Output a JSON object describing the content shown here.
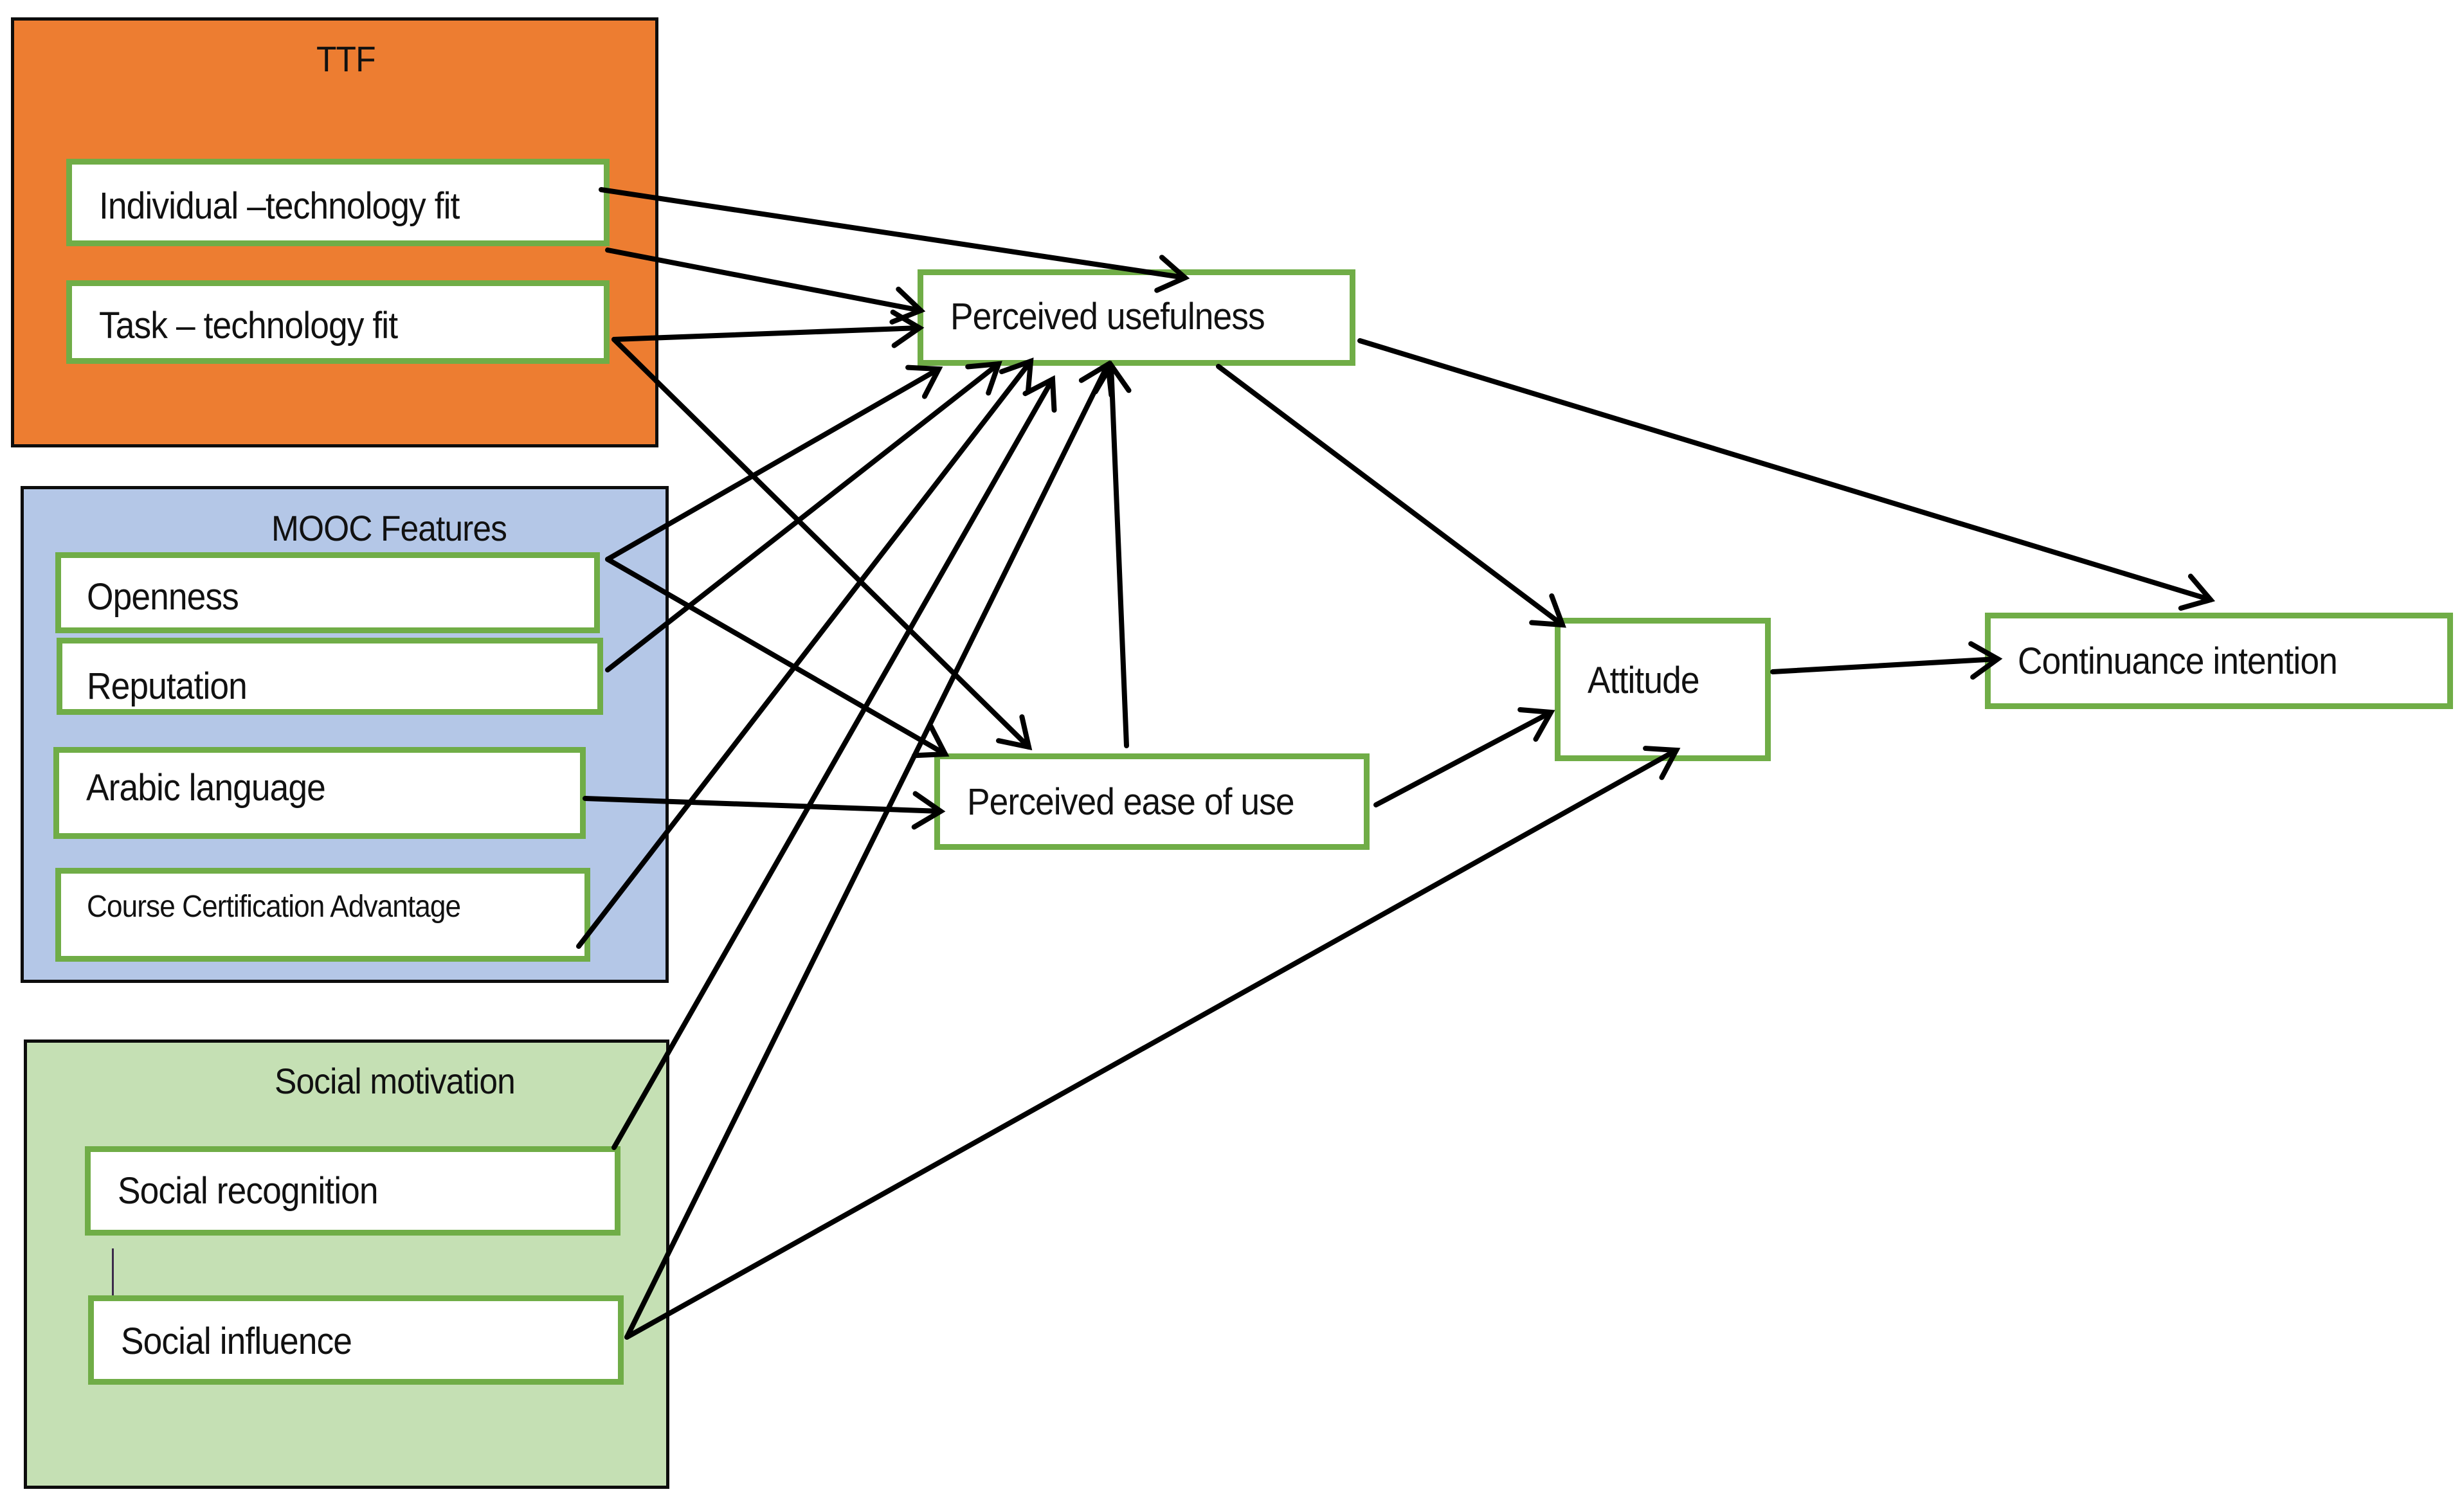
{
  "diagram": {
    "type": "research-model",
    "colors": {
      "ttf_group": "#ED7D31",
      "mooc_group": "#B4C7E7",
      "social_group": "#C5E0B4",
      "node_border": "#70AD47",
      "group_border": "#0D0D0D",
      "edge": "#000000"
    },
    "groups": [
      {
        "id": "ttf",
        "label": "TTF"
      },
      {
        "id": "mooc",
        "label": "MOOC Features"
      },
      {
        "id": "social",
        "label": "Social motivation"
      }
    ],
    "nodes": {
      "individual_fit": {
        "label": "Individual –technology fit",
        "group": "ttf"
      },
      "task_fit": {
        "label": "Task – technology fit",
        "group": "ttf"
      },
      "openness": {
        "label": "Openness",
        "group": "mooc"
      },
      "reputation": {
        "label": "Reputation",
        "group": "mooc"
      },
      "arabic": {
        "label": "Arabic language",
        "group": "mooc"
      },
      "certification": {
        "label": "Course Certification Advantage",
        "group": "mooc"
      },
      "social_recognition": {
        "label": "Social recognition",
        "group": "social"
      },
      "social_influence": {
        "label": "Social influence",
        "group": "social"
      },
      "pu": {
        "label": "Perceived usefulness"
      },
      "peou": {
        "label": "Perceived ease of use"
      },
      "attitude": {
        "label": "Attitude"
      },
      "ci": {
        "label": "Continuance intention"
      }
    },
    "edges": [
      {
        "from": "individual_fit",
        "to": "pu"
      },
      {
        "from": "individual_fit",
        "to": "pu"
      },
      {
        "from": "task_fit",
        "to": "pu"
      },
      {
        "from": "task_fit",
        "to": "peou"
      },
      {
        "from": "openness",
        "to": "pu"
      },
      {
        "from": "openness",
        "to": "peou"
      },
      {
        "from": "reputation",
        "to": "pu"
      },
      {
        "from": "arabic",
        "to": "peou"
      },
      {
        "from": "certification",
        "to": "pu"
      },
      {
        "from": "social_recognition",
        "to": "pu"
      },
      {
        "from": "social_influence",
        "to": "pu"
      },
      {
        "from": "social_influence",
        "to": "attitude"
      },
      {
        "from": "peou",
        "to": "pu"
      },
      {
        "from": "pu",
        "to": "attitude"
      },
      {
        "from": "pu",
        "to": "ci"
      },
      {
        "from": "peou",
        "to": "attitude"
      },
      {
        "from": "attitude",
        "to": "ci"
      }
    ]
  }
}
